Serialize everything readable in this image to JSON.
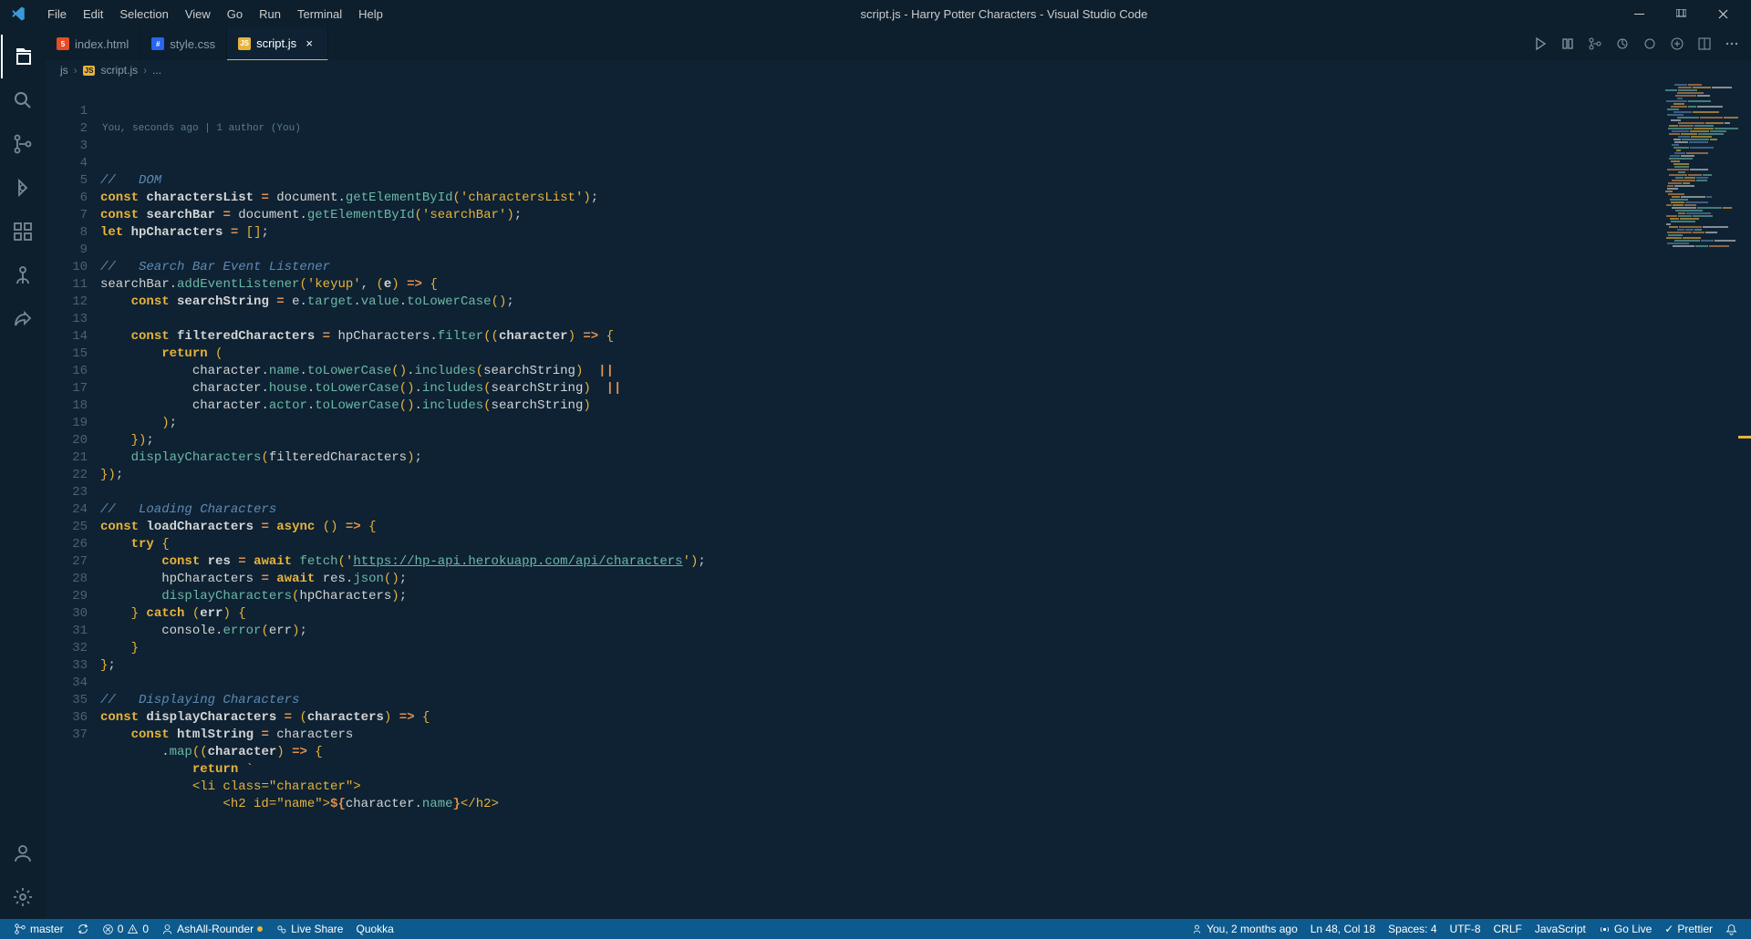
{
  "window": {
    "title": "script.js - Harry Potter Characters - Visual Studio Code"
  },
  "menu": [
    "File",
    "Edit",
    "Selection",
    "View",
    "Go",
    "Run",
    "Terminal",
    "Help"
  ],
  "tabs": [
    {
      "label": "index.html",
      "icon": "html",
      "active": false
    },
    {
      "label": "style.css",
      "icon": "css",
      "active": false
    },
    {
      "label": "script.js",
      "icon": "js",
      "active": true
    }
  ],
  "breadcrumb": [
    "js",
    "script.js",
    "..."
  ],
  "codelens": "You, seconds ago | 1 author (You)",
  "code_lines": [
    {
      "n": 1,
      "segs": [
        [
          "c-comment",
          "//   DOM"
        ]
      ]
    },
    {
      "n": 2,
      "segs": [
        [
          "c-const",
          "const "
        ],
        [
          "c-ident c-bold",
          "charactersList"
        ],
        [
          "c-op",
          " = "
        ],
        [
          "c-ident",
          "document"
        ],
        [
          "c-punct",
          "."
        ],
        [
          "c-method",
          "getElementById"
        ],
        [
          "c-paren",
          "("
        ],
        [
          "c-string",
          "'charactersList'"
        ],
        [
          "c-paren",
          ")"
        ],
        [
          "c-punct",
          ";"
        ]
      ]
    },
    {
      "n": 3,
      "segs": [
        [
          "c-const",
          "const "
        ],
        [
          "c-ident c-bold",
          "searchBar"
        ],
        [
          "c-op",
          " = "
        ],
        [
          "c-ident",
          "document"
        ],
        [
          "c-punct",
          "."
        ],
        [
          "c-method",
          "getElementById"
        ],
        [
          "c-paren",
          "("
        ],
        [
          "c-string",
          "'searchBar'"
        ],
        [
          "c-paren",
          ")"
        ],
        [
          "c-punct",
          ";"
        ]
      ]
    },
    {
      "n": 4,
      "segs": [
        [
          "c-const",
          "let "
        ],
        [
          "c-ident c-bold",
          "hpCharacters"
        ],
        [
          "c-op",
          " = "
        ],
        [
          "c-paren",
          "["
        ],
        [
          "c-paren",
          "]"
        ],
        [
          "c-punct",
          ";"
        ]
      ]
    },
    {
      "n": 5,
      "segs": []
    },
    {
      "n": 6,
      "segs": [
        [
          "c-comment",
          "//   Search Bar Event Listener"
        ]
      ]
    },
    {
      "n": 7,
      "segs": [
        [
          "c-ident",
          "searchBar"
        ],
        [
          "c-punct",
          "."
        ],
        [
          "c-method",
          "addEventListener"
        ],
        [
          "c-paren",
          "("
        ],
        [
          "c-string",
          "'keyup'"
        ],
        [
          "c-punct",
          ", "
        ],
        [
          "c-paren",
          "("
        ],
        [
          "c-ident c-bold",
          "e"
        ],
        [
          "c-paren",
          ")"
        ],
        [
          "c-arrow",
          " => "
        ],
        [
          "c-paren",
          "{"
        ]
      ]
    },
    {
      "n": 8,
      "segs": [
        [
          "c-white",
          "    "
        ],
        [
          "c-const",
          "const "
        ],
        [
          "c-ident c-bold",
          "searchString"
        ],
        [
          "c-op",
          " = "
        ],
        [
          "c-ident",
          "e"
        ],
        [
          "c-punct",
          "."
        ],
        [
          "c-prop",
          "target"
        ],
        [
          "c-punct",
          "."
        ],
        [
          "c-prop",
          "value"
        ],
        [
          "c-punct",
          "."
        ],
        [
          "c-method",
          "toLowerCase"
        ],
        [
          "c-paren",
          "()"
        ],
        [
          "c-punct",
          ";"
        ]
      ]
    },
    {
      "n": 9,
      "segs": []
    },
    {
      "n": 10,
      "segs": [
        [
          "c-white",
          "    "
        ],
        [
          "c-const",
          "const "
        ],
        [
          "c-ident c-bold",
          "filteredCharacters"
        ],
        [
          "c-op",
          " = "
        ],
        [
          "c-ident",
          "hpCharacters"
        ],
        [
          "c-punct",
          "."
        ],
        [
          "c-method",
          "filter"
        ],
        [
          "c-paren",
          "(("
        ],
        [
          "c-ident c-bold",
          "character"
        ],
        [
          "c-paren",
          ")"
        ],
        [
          "c-arrow",
          " => "
        ],
        [
          "c-paren",
          "{"
        ]
      ]
    },
    {
      "n": 11,
      "segs": [
        [
          "c-white",
          "        "
        ],
        [
          "c-keyword",
          "return "
        ],
        [
          "c-paren",
          "("
        ]
      ]
    },
    {
      "n": 12,
      "segs": [
        [
          "c-white",
          "            "
        ],
        [
          "c-ident",
          "character"
        ],
        [
          "c-punct",
          "."
        ],
        [
          "c-prop",
          "name"
        ],
        [
          "c-punct",
          "."
        ],
        [
          "c-method",
          "toLowerCase"
        ],
        [
          "c-paren",
          "()"
        ],
        [
          "c-punct",
          "."
        ],
        [
          "c-method",
          "includes"
        ],
        [
          "c-paren",
          "("
        ],
        [
          "c-ident",
          "searchString"
        ],
        [
          "c-paren",
          ")"
        ],
        [
          "c-op",
          "  ||"
        ]
      ]
    },
    {
      "n": 13,
      "segs": [
        [
          "c-white",
          "            "
        ],
        [
          "c-ident",
          "character"
        ],
        [
          "c-punct",
          "."
        ],
        [
          "c-prop",
          "house"
        ],
        [
          "c-punct",
          "."
        ],
        [
          "c-method",
          "toLowerCase"
        ],
        [
          "c-paren",
          "()"
        ],
        [
          "c-punct",
          "."
        ],
        [
          "c-method",
          "includes"
        ],
        [
          "c-paren",
          "("
        ],
        [
          "c-ident",
          "searchString"
        ],
        [
          "c-paren",
          ")"
        ],
        [
          "c-op",
          "  ||"
        ]
      ]
    },
    {
      "n": 14,
      "segs": [
        [
          "c-white",
          "            "
        ],
        [
          "c-ident",
          "character"
        ],
        [
          "c-punct",
          "."
        ],
        [
          "c-prop",
          "actor"
        ],
        [
          "c-punct",
          "."
        ],
        [
          "c-method",
          "toLowerCase"
        ],
        [
          "c-paren",
          "()"
        ],
        [
          "c-punct",
          "."
        ],
        [
          "c-method",
          "includes"
        ],
        [
          "c-paren",
          "("
        ],
        [
          "c-ident",
          "searchString"
        ],
        [
          "c-paren",
          ")"
        ]
      ]
    },
    {
      "n": 15,
      "segs": [
        [
          "c-white",
          "        "
        ],
        [
          "c-paren",
          ")"
        ],
        [
          "c-punct",
          ";"
        ]
      ]
    },
    {
      "n": 16,
      "segs": [
        [
          "c-white",
          "    "
        ],
        [
          "c-paren",
          "})"
        ],
        [
          "c-punct",
          ";"
        ]
      ]
    },
    {
      "n": 17,
      "segs": [
        [
          "c-white",
          "    "
        ],
        [
          "c-method",
          "displayCharacters"
        ],
        [
          "c-paren",
          "("
        ],
        [
          "c-ident",
          "filteredCharacters"
        ],
        [
          "c-paren",
          ")"
        ],
        [
          "c-punct",
          ";"
        ]
      ]
    },
    {
      "n": 18,
      "segs": [
        [
          "c-paren",
          "})"
        ],
        [
          "c-punct",
          ";"
        ]
      ]
    },
    {
      "n": 19,
      "segs": []
    },
    {
      "n": 20,
      "segs": [
        [
          "c-comment",
          "//   Loading Characters"
        ]
      ]
    },
    {
      "n": 21,
      "segs": [
        [
          "c-const",
          "const "
        ],
        [
          "c-ident c-bold",
          "loadCharacters"
        ],
        [
          "c-op",
          " = "
        ],
        [
          "c-keyword",
          "async "
        ],
        [
          "c-paren",
          "()"
        ],
        [
          "c-arrow",
          " => "
        ],
        [
          "c-paren",
          "{"
        ]
      ]
    },
    {
      "n": 22,
      "segs": [
        [
          "c-white",
          "    "
        ],
        [
          "c-keyword",
          "try "
        ],
        [
          "c-paren",
          "{"
        ]
      ]
    },
    {
      "n": 23,
      "segs": [
        [
          "c-white",
          "        "
        ],
        [
          "c-const",
          "const "
        ],
        [
          "c-ident c-bold",
          "res"
        ],
        [
          "c-op",
          " = "
        ],
        [
          "c-keyword",
          "await "
        ],
        [
          "c-method",
          "fetch"
        ],
        [
          "c-paren",
          "("
        ],
        [
          "c-string",
          "'"
        ],
        [
          "c-url",
          "https://hp-api.herokuapp.com/api/characters"
        ],
        [
          "c-string",
          "'"
        ],
        [
          "c-paren",
          ")"
        ],
        [
          "c-punct",
          ";"
        ]
      ]
    },
    {
      "n": 24,
      "segs": [
        [
          "c-white",
          "        "
        ],
        [
          "c-ident",
          "hpCharacters"
        ],
        [
          "c-op",
          " = "
        ],
        [
          "c-keyword",
          "await "
        ],
        [
          "c-ident",
          "res"
        ],
        [
          "c-punct",
          "."
        ],
        [
          "c-method",
          "json"
        ],
        [
          "c-paren",
          "()"
        ],
        [
          "c-punct",
          ";"
        ]
      ]
    },
    {
      "n": 25,
      "segs": [
        [
          "c-white",
          "        "
        ],
        [
          "c-method",
          "displayCharacters"
        ],
        [
          "c-paren",
          "("
        ],
        [
          "c-ident",
          "hpCharacters"
        ],
        [
          "c-paren",
          ")"
        ],
        [
          "c-punct",
          ";"
        ]
      ]
    },
    {
      "n": 26,
      "segs": [
        [
          "c-white",
          "    "
        ],
        [
          "c-paren",
          "}"
        ],
        [
          "c-keyword",
          " catch "
        ],
        [
          "c-paren",
          "("
        ],
        [
          "c-ident c-bold",
          "err"
        ],
        [
          "c-paren",
          ")"
        ],
        [
          "c-white",
          " "
        ],
        [
          "c-paren",
          "{"
        ]
      ]
    },
    {
      "n": 27,
      "segs": [
        [
          "c-white",
          "        "
        ],
        [
          "c-ident",
          "console"
        ],
        [
          "c-punct",
          "."
        ],
        [
          "c-method",
          "error"
        ],
        [
          "c-paren",
          "("
        ],
        [
          "c-ident",
          "err"
        ],
        [
          "c-paren",
          ")"
        ],
        [
          "c-punct",
          ";"
        ]
      ]
    },
    {
      "n": 28,
      "segs": [
        [
          "c-white",
          "    "
        ],
        [
          "c-paren",
          "}"
        ]
      ]
    },
    {
      "n": 29,
      "segs": [
        [
          "c-paren",
          "}"
        ],
        [
          "c-punct",
          ";"
        ]
      ]
    },
    {
      "n": 30,
      "segs": []
    },
    {
      "n": 31,
      "segs": [
        [
          "c-comment",
          "//   Displaying Characters"
        ]
      ]
    },
    {
      "n": 32,
      "segs": [
        [
          "c-const",
          "const "
        ],
        [
          "c-ident c-bold",
          "displayCharacters"
        ],
        [
          "c-op",
          " = "
        ],
        [
          "c-paren",
          "("
        ],
        [
          "c-ident c-bold",
          "characters"
        ],
        [
          "c-paren",
          ")"
        ],
        [
          "c-arrow",
          " => "
        ],
        [
          "c-paren",
          "{"
        ]
      ]
    },
    {
      "n": 33,
      "segs": [
        [
          "c-white",
          "    "
        ],
        [
          "c-const",
          "const "
        ],
        [
          "c-ident c-bold",
          "htmlString"
        ],
        [
          "c-op",
          " = "
        ],
        [
          "c-ident",
          "characters"
        ]
      ]
    },
    {
      "n": 34,
      "segs": [
        [
          "c-white",
          "        "
        ],
        [
          "c-punct",
          "."
        ],
        [
          "c-method",
          "map"
        ],
        [
          "c-paren",
          "(("
        ],
        [
          "c-ident c-bold",
          "character"
        ],
        [
          "c-paren",
          ")"
        ],
        [
          "c-arrow",
          " => "
        ],
        [
          "c-paren",
          "{"
        ]
      ]
    },
    {
      "n": 35,
      "segs": [
        [
          "c-white",
          "            "
        ],
        [
          "c-keyword",
          "return "
        ],
        [
          "c-string",
          "`"
        ]
      ]
    },
    {
      "n": 36,
      "segs": [
        [
          "c-white",
          "            "
        ],
        [
          "c-string",
          "<li class=\"character\">"
        ]
      ]
    },
    {
      "n": 37,
      "segs": [
        [
          "c-white",
          "                "
        ],
        [
          "c-string",
          "<h2 id=\"name\">"
        ],
        [
          "c-op",
          "${"
        ],
        [
          "c-ident",
          "character"
        ],
        [
          "c-punct",
          "."
        ],
        [
          "c-prop",
          "name"
        ],
        [
          "c-op",
          "}"
        ],
        [
          "c-string",
          "</h2>"
        ]
      ]
    }
  ],
  "statusbar": {
    "branch": "master",
    "sync": "",
    "errors": "0",
    "warnings": "0",
    "user": "AshAll-Rounder",
    "liveshare": "Live Share",
    "quokka": "Quokka",
    "blame": "You, 2 months ago",
    "position": "Ln 48, Col 18",
    "spaces": "Spaces: 4",
    "encoding": "UTF-8",
    "eol": "CRLF",
    "language": "JavaScript",
    "golive": "Go Live",
    "prettier": "Prettier"
  }
}
